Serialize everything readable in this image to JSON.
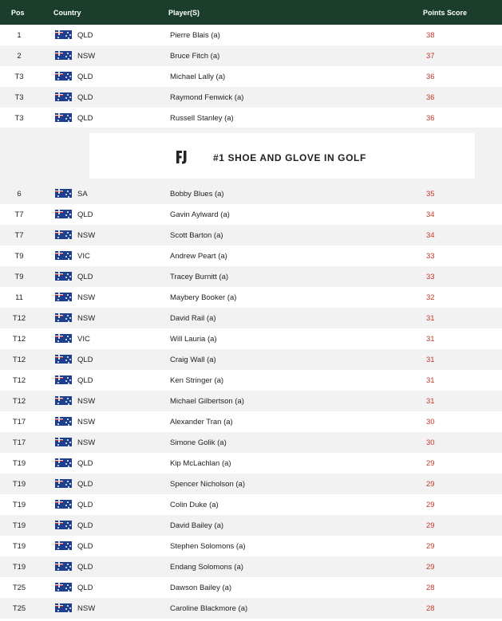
{
  "header": {
    "pos": "Pos",
    "country": "Country",
    "player": "Player(S)",
    "score": "Points Score"
  },
  "promo": {
    "logo": "FJ",
    "text": "#1 SHOE AND GLOVE IN GOLF"
  },
  "colors": {
    "header_bg": "#1b3d2b",
    "score": "#c0392b",
    "row_alt": "#f2f2f2"
  },
  "flag_icon": "australia-flag-icon",
  "rows": [
    {
      "pos": "1",
      "state": "QLD",
      "player": "Pierre Blais (a)",
      "score": "38"
    },
    {
      "pos": "2",
      "state": "NSW",
      "player": "Bruce Fitch (a)",
      "score": "37"
    },
    {
      "pos": "T3",
      "state": "QLD",
      "player": "Michael Lally (a)",
      "score": "36"
    },
    {
      "pos": "T3",
      "state": "QLD",
      "player": "Raymond Fenwick (a)",
      "score": "36"
    },
    {
      "pos": "T3",
      "state": "QLD",
      "player": "Russell Stanley (a)",
      "score": "36"
    },
    {
      "pos": "6",
      "state": "SA",
      "player": "Bobby Blues (a)",
      "score": "35"
    },
    {
      "pos": "T7",
      "state": "QLD",
      "player": "Gavin Aylward (a)",
      "score": "34"
    },
    {
      "pos": "T7",
      "state": "NSW",
      "player": "Scott Barton (a)",
      "score": "34"
    },
    {
      "pos": "T9",
      "state": "VIC",
      "player": "Andrew Peart (a)",
      "score": "33"
    },
    {
      "pos": "T9",
      "state": "QLD",
      "player": "Tracey Burnitt (a)",
      "score": "33"
    },
    {
      "pos": "11",
      "state": "NSW",
      "player": "Maybery Booker (a)",
      "score": "32"
    },
    {
      "pos": "T12",
      "state": "NSW",
      "player": "David Rail (a)",
      "score": "31"
    },
    {
      "pos": "T12",
      "state": "VIC",
      "player": "Will Lauria (a)",
      "score": "31"
    },
    {
      "pos": "T12",
      "state": "QLD",
      "player": "Craig Wall (a)",
      "score": "31"
    },
    {
      "pos": "T12",
      "state": "QLD",
      "player": "Ken Stringer (a)",
      "score": "31"
    },
    {
      "pos": "T12",
      "state": "NSW",
      "player": "Michael Gilbertson (a)",
      "score": "31"
    },
    {
      "pos": "T17",
      "state": "NSW",
      "player": "Alexander Tran (a)",
      "score": "30"
    },
    {
      "pos": "T17",
      "state": "NSW",
      "player": "Simone Golik (a)",
      "score": "30"
    },
    {
      "pos": "T19",
      "state": "QLD",
      "player": "Kip McLachlan (a)",
      "score": "29"
    },
    {
      "pos": "T19",
      "state": "QLD",
      "player": "Spencer Nicholson (a)",
      "score": "29"
    },
    {
      "pos": "T19",
      "state": "QLD",
      "player": "Colin Duke (a)",
      "score": "29"
    },
    {
      "pos": "T19",
      "state": "QLD",
      "player": "David Bailey (a)",
      "score": "29"
    },
    {
      "pos": "T19",
      "state": "QLD",
      "player": "Stephen Solomons (a)",
      "score": "29"
    },
    {
      "pos": "T19",
      "state": "QLD",
      "player": "Endang Solomons (a)",
      "score": "29"
    },
    {
      "pos": "T25",
      "state": "QLD",
      "player": "Dawson Bailey (a)",
      "score": "28"
    },
    {
      "pos": "T25",
      "state": "NSW",
      "player": "Caroline Blackmore (a)",
      "score": "28"
    }
  ]
}
